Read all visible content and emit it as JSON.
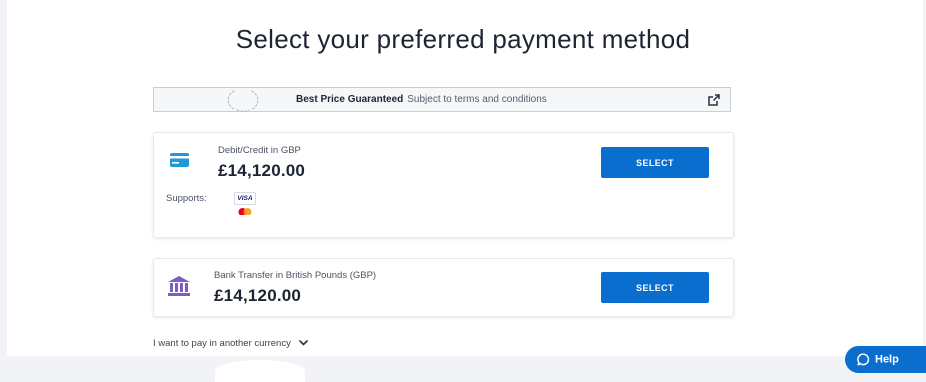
{
  "header": {
    "title": "Select your preferred payment method"
  },
  "banner": {
    "strong": "Best Price Guaranteed",
    "sub": "Subject to terms and conditions",
    "icon": "external-link-icon"
  },
  "methods": [
    {
      "label": "Debit/Credit in GBP",
      "amount": "£14,120.00",
      "button": "SELECT",
      "icon": "credit-card-icon",
      "supports_label": "Supports:",
      "card_brands": [
        "VISA",
        "mastercard"
      ]
    },
    {
      "label": "Bank Transfer in British Pounds (GBP)",
      "amount": "£14,120.00",
      "button": "SELECT",
      "icon": "bank-icon"
    }
  ],
  "other_currency": {
    "label": "I want to pay in another currency",
    "icon": "chevron-down-icon"
  },
  "help": {
    "label": "Help",
    "icon": "chat-bubble-icon"
  },
  "colors": {
    "primary": "#0a6ecf",
    "card_icon": "#1e9bd7",
    "bank_icon": "#7b5cc8"
  }
}
